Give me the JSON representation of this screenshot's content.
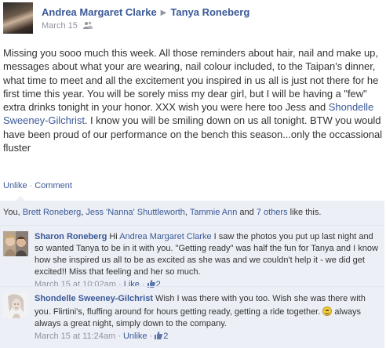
{
  "post": {
    "author": "Andrea Margaret Clarke",
    "arrow": "▶",
    "recipient": "Tanya Roneberg",
    "date": "March 15",
    "audience_icon": "people-icon",
    "body_part1": "Missing you sooo much this week. All those reminders about hair, nail and make up, messages about what your are wearing, nail colour included, to the Taipan's dinner, what time to meet and all the excitement you inspired in us all is just not there for he first time this year. You will be sorely miss my dear girl, but I will be having a \"few\" extra drinks tonight in your honor. XXX wish you were here too Jess and ",
    "body_mention": "Shondelle Sweeney-Gilchrist",
    "body_part2": ". I know you will be smiling down on us all tonight. BTW you would have been proud of our performance on the bench this season...only the occassional fluster"
  },
  "actions": {
    "unlike": "Unlike",
    "sep": "·",
    "comment": "Comment"
  },
  "likes": {
    "prefix": "You, ",
    "person1": "Brett Roneberg",
    "comma1": ", ",
    "person2": "Jess 'Nanna' Shuttleworth",
    "comma2": ", ",
    "person3": "Tammie Ann",
    "and": " and ",
    "others": "7 others",
    "suffix": " like this."
  },
  "comments": [
    {
      "author": "Sharon Roneberg",
      "text_a": " Hi ",
      "mention": "Andrea Margaret Clarke",
      "text_b": " I saw the photos you put up last night and so wanted Tanya to be in it with you. \"Getting ready\" was half the fun for Tanya and I know how she inspired us all to be as excited as she was and we couldn't help it - we did get excited!! Miss that feeling and her so much.",
      "time": "March 15 at 10:02am",
      "sep": "·",
      "action": "Like",
      "likes": "2"
    },
    {
      "author": "Shondelle Sweeney-Gilchrist",
      "text_a": " Wish I was there with you too. Wish she was there with you. Flirtini's, fluffing around for hours getting ready, getting a ride together. ",
      "text_b": " always always a great night, simply down to the company.",
      "time": "March 15 at 11:24am",
      "sep": "·",
      "action": "Unlike",
      "likes": "2"
    }
  ],
  "colors": {
    "link": "#3b5998",
    "ufi_bg": "#eceff5",
    "meta": "#90949c",
    "text": "#333333"
  }
}
